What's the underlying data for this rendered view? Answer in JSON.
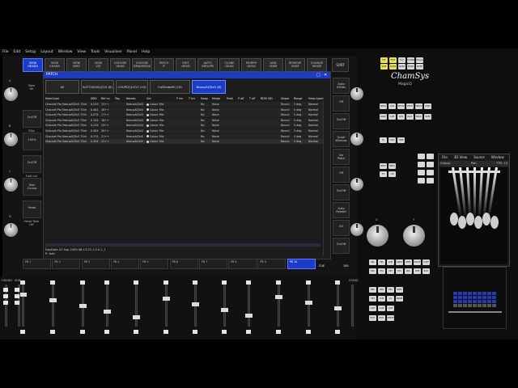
{
  "menubar": {
    "items": [
      "File",
      "Edit",
      "Setup",
      "Layout",
      "Window",
      "View",
      "Tools",
      "Visualiser",
      "Panel",
      "Help"
    ]
  },
  "top_buttons": [
    {
      "label": "VIEW\nHEADS",
      "active": true
    },
    {
      "label": "VIEW\nCHANS",
      "active": false
    },
    {
      "label": "VIEW\nDMX",
      "active": false
    },
    {
      "label": "VIEW\nV/E",
      "active": false
    },
    {
      "label": "CHOOSE\nHEAD",
      "active": false
    },
    {
      "label": "CHOOSE\nDMX/MEDIA",
      "active": false
    },
    {
      "label": "PATCH\nIT",
      "active": false
    },
    {
      "label": "EDIT\nHEAD",
      "active": false
    },
    {
      "label": "AUTO\nGROUPS",
      "active": false
    },
    {
      "label": "CLONE\nHEAD",
      "active": false
    },
    {
      "label": "MORPH\nHEAD",
      "active": false
    },
    {
      "label": "ADD\nVDIM",
      "active": false
    },
    {
      "label": "REMOVE\nVDIM",
      "active": false
    },
    {
      "label": "CHANGE\nMODE",
      "active": false
    }
  ],
  "sort_button": "SORT",
  "left_encoders": [
    {
      "label": "Slow\nAll",
      "letter": "A"
    },
    {
      "label": "Filte",
      "letter": "B"
    },
    {
      "label": "Fold Uni",
      "letter": "C"
    },
    {
      "label": "Head Task\nOff",
      "letter": "D"
    }
  ],
  "left_side_buttons": [
    "On/Off",
    "100%",
    "On/Off",
    "Task\nCursor",
    "Head"
  ],
  "right_side_buttons": [
    "Auto\nIDHds",
    "Off",
    "On/Off",
    "Scroll\nWindow",
    "No\nPatch",
    "Off",
    "On/Off",
    "Auto\nPalette",
    "All",
    "On/Off"
  ],
  "patch_window": {
    "title": "PATCH",
    "tabs": [
      {
        "label": "All",
        "active": false
      },
      {
        "label": "AUTO4000(4/20 (8)",
        "active": false
      },
      {
        "label": "COUPLE/LH12 (10)",
        "active": false
      },
      {
        "label": "CoStrobeM (16)",
        "active": false
      },
      {
        "label": "NexusAQ5x5 (8)",
        "active": true
      }
    ],
    "columns": [
      "Head type",
      "DMX",
      "Ref no",
      "Tag",
      "Names",
      "Gel",
      "P inv",
      "T inv",
      "Swap",
      "Merge",
      "Posit",
      "P off",
      "T off",
      "RDM UID",
      "Shape",
      "Range",
      "Heap types"
    ],
    "rows": [
      [
        "Chauvet Pro NexusAQ5x5 75ch",
        "0.229",
        "15++",
        "",
        "NexusAQ5x5",
        "Colour Mix",
        "",
        "",
        "No",
        "None",
        "",
        "",
        "",
        "",
        "Round",
        "5 deg",
        "Normal"
      ],
      [
        "Chauvet Pro NexusAQ5x5 75ch",
        "0.404",
        "16++",
        "",
        "NexusAQ5x5",
        "Colour Mix",
        "",
        "",
        "No",
        "None",
        "",
        "",
        "",
        "",
        "Round",
        "5 deg",
        "Normal"
      ],
      [
        "Chauvet Pro NexusAQ5x5 75ch",
        "0.079",
        "17++",
        "",
        "NexusAQ5x5",
        "Colour Mix",
        "",
        "",
        "No",
        "None",
        "",
        "",
        "",
        "",
        "Round",
        "5 deg",
        "Normal"
      ],
      [
        "Chauvet Pro NexusAQ5x5 75ch",
        "0.154",
        "18++",
        "",
        "NexusAQ5x5",
        "Colour Mix",
        "",
        "",
        "No",
        "None",
        "",
        "",
        "",
        "",
        "Round",
        "5 deg",
        "Normal"
      ],
      [
        "Chauvet Pro NexusAQ5x5 75ch",
        "0.229",
        "19++",
        "",
        "NexusAQ5x5",
        "Colour Mix",
        "",
        "",
        "No",
        "None",
        "",
        "",
        "",
        "",
        "Round",
        "5 deg",
        "Normal"
      ],
      [
        "Chauvet Pro NexusAQ5x5 75ch",
        "0.304",
        "20++",
        "",
        "NexusAQ5x5",
        "Colour Mix",
        "",
        "",
        "No",
        "None",
        "",
        "",
        "",
        "",
        "Round",
        "5 deg",
        "Normal"
      ],
      [
        "Chauvet Pro NexusAQ5x5 75ch",
        "0.379",
        "21++",
        "",
        "NexusAQ5x5",
        "Colour Mix",
        "",
        "",
        "No",
        "None",
        "",
        "",
        "",
        "",
        "Round",
        "5 deg",
        "Normal"
      ],
      [
        "Chauvet Pro NexusAQ5x5 75ch",
        "0.454",
        "22++",
        "",
        "NexusAQ5x5",
        "Colour Mix",
        "",
        "",
        "No",
        "None",
        "",
        "",
        "",
        "",
        "Round",
        "5 deg",
        "Normal"
      ]
    ],
    "status_line_1": "DayDate 22 Sep 2009 08:13:23 1.0.0.1_1",
    "status_line_2": "P: Add"
  },
  "playback_buttons": [
    {
      "label": "PB 1",
      "active": false
    },
    {
      "label": "PB 2",
      "active": false
    },
    {
      "label": "PB 3",
      "active": false
    },
    {
      "label": "PB 4",
      "active": false
    },
    {
      "label": "PB 5",
      "active": false
    },
    {
      "label": "PB 6",
      "active": false
    },
    {
      "label": "PB 7",
      "active": false
    },
    {
      "label": "PB 8",
      "active": false
    },
    {
      "label": "PB 9",
      "active": false
    },
    {
      "label": "PB 10",
      "active": true
    }
  ],
  "pb10_detail": {
    "cue": "CUE",
    "level": "100"
  },
  "brand": {
    "name": "ChamSys",
    "product": "MagicQ"
  },
  "viz_window": {
    "menu": [
      "File",
      "3D View",
      "Source",
      "Window"
    ],
    "status_left": "Output",
    "status_mid": "Pan",
    "status_right": "FPS: 10"
  },
  "xy_labels": {
    "x": "X",
    "y": "Y"
  },
  "fader_section": {
    "grand": "GRAND",
    "sub": "SUB",
    "stage": "STAGE"
  },
  "keypad_rows": [
    [
      "FLT",
      "FLT2",
      "Tcol",
      "TchRBO",
      "Simple"
    ],
    [
      "Shift",
      "Shift2",
      "Shift3",
      "Shift4",
      "Shift5"
    ],
    [
      "PROG",
      "OUT",
      "SETUP",
      "PTCH",
      "MEDIA",
      "EXEC"
    ],
    [
      "PAGE",
      "CUE",
      "STK",
      "PLAY",
      "BACK",
      "STEP"
    ],
    [
      "HI",
      "FLOT",
      "TIME"
    ],
    [
      "NEXT",
      "PREV"
    ],
    [
      "FX",
      "LIN"
    ],
    [
      "SEL",
      "SEL",
      "CUE",
      "UNDO",
      "REM",
      "MOVE",
      "COPY"
    ],
    [
      "INC",
      "MO",
      "SET",
      "SYC",
      "PRC",
      "HHE",
      "ROC"
    ],
    [
      "REC",
      "UPD",
      "INC",
      "REM"
    ],
    [
      "SET",
      "CUE",
      "CL",
      "NAME"
    ],
    [
      "LAST",
      "LAST",
      "LAST"
    ],
    [
      "EXIT",
      "EXIT",
      "ENTER"
    ]
  ],
  "colors": {
    "accent": "#1a3cc8",
    "panel": "#141414",
    "key_yellow": "#e8e05a"
  }
}
